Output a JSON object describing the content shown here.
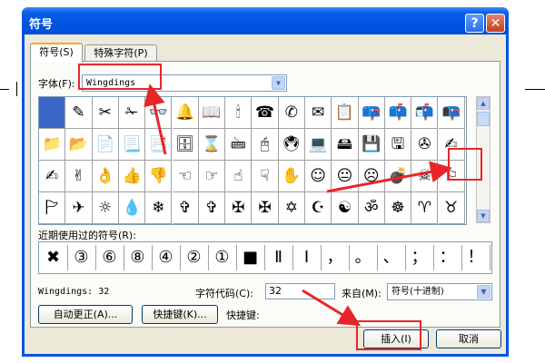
{
  "window": {
    "title": "符号",
    "help_glyph": "?",
    "close_glyph": "✕"
  },
  "tabs": [
    {
      "label": "符号(S)",
      "active": true
    },
    {
      "label": "特殊字符(P)",
      "active": false
    }
  ],
  "font": {
    "label": "字体(F):",
    "value": "Wingdings"
  },
  "symbols": [
    [
      "",
      "✎",
      "✂",
      "✁",
      "👓",
      "🔔",
      "📖",
      "🕯",
      "☎",
      "✆",
      "✉",
      "📋",
      "📪",
      "📫",
      "📬",
      "📭"
    ],
    [
      "📁",
      "📂",
      "📄",
      "📃",
      "📑",
      "🗄",
      "⌛",
      "🖮",
      "🖰",
      "🖲",
      "💻",
      "🖴",
      "💾",
      "🖫",
      "✇",
      "✍"
    ],
    [
      "✍",
      "✌",
      "👌",
      "👍",
      "👎",
      "☜",
      "☞",
      "☝",
      "☟",
      "✋",
      "☺",
      "😐",
      "☹",
      "💣",
      "☠",
      "⚐"
    ],
    [
      "🏱",
      "✈",
      "☼",
      "💧",
      "❄",
      "✞",
      "✞",
      "✠",
      "✠",
      "✡",
      "☪",
      "☯",
      "ॐ",
      "☸",
      "♈",
      "♉"
    ]
  ],
  "recent": {
    "label": "近期使用过的符号(R):",
    "items": [
      "✖",
      "③",
      "⑥",
      "⑧",
      "④",
      "②",
      "①",
      "■",
      "Ⅱ",
      "Ⅰ",
      "，",
      "。",
      "、",
      "；",
      "：",
      "！"
    ]
  },
  "status": {
    "font_code": "Wingdings: 32",
    "char_code_label": "字符代码(C):",
    "char_code_value": "32",
    "from_label": "来自(M):",
    "from_value": "符号(十进制)"
  },
  "buttons": {
    "autocorrect": "自动更正(A)...",
    "shortcut_key": "快捷键(K)...",
    "shortcut_label": "快捷键:",
    "insert": "插入(I)",
    "cancel": "取消"
  },
  "accent_colors": {
    "annotation": "#e8262a",
    "title_bar": "#0054e3",
    "selection": "#3a66c8"
  },
  "icons": {
    "dropdown": "▼",
    "scroll_up": "▲",
    "scroll_down": "▼"
  }
}
